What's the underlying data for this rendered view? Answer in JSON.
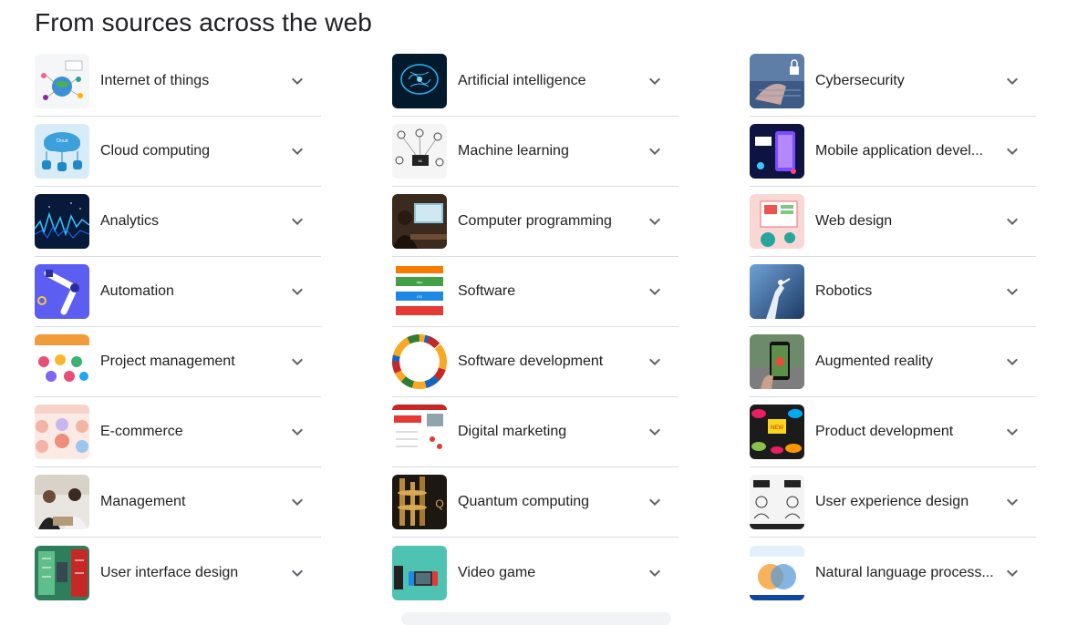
{
  "section": {
    "title": "From sources across the web"
  },
  "columns": [
    {
      "items": [
        {
          "label": "Internet of things",
          "icon": "iot-diagram-image"
        },
        {
          "label": "Cloud computing",
          "icon": "cloud-computing-image"
        },
        {
          "label": "Analytics",
          "icon": "analytics-waveform-image"
        },
        {
          "label": "Automation",
          "icon": "robot-arm-image"
        },
        {
          "label": "Project management",
          "icon": "project-management-chart-image"
        },
        {
          "label": "E-commerce",
          "icon": "ecommerce-types-image"
        },
        {
          "label": "Management",
          "icon": "business-meeting-photo"
        },
        {
          "label": "User interface design",
          "icon": "ui-wireframe-image"
        }
      ]
    },
    {
      "items": [
        {
          "label": "Artificial intelligence",
          "icon": "ai-brain-image"
        },
        {
          "label": "Machine learning",
          "icon": "machine-learning-sketch-image"
        },
        {
          "label": "Computer programming",
          "icon": "programmer-photo"
        },
        {
          "label": "Software",
          "icon": "software-layers-image"
        },
        {
          "label": "Software development",
          "icon": "sdlc-cycle-image"
        },
        {
          "label": "Digital marketing",
          "icon": "digital-marketing-image"
        },
        {
          "label": "Quantum computing",
          "icon": "quantum-computer-photo"
        },
        {
          "label": "Video game",
          "icon": "game-console-image"
        }
      ]
    },
    {
      "items": [
        {
          "label": "Cybersecurity",
          "icon": "keyboard-lock-photo"
        },
        {
          "label": "Mobile application devel...",
          "icon": "mobile-app-image"
        },
        {
          "label": "Web design",
          "icon": "web-design-illustration"
        },
        {
          "label": "Robotics",
          "icon": "robot-hand-photo"
        },
        {
          "label": "Augmented reality",
          "icon": "ar-phone-photo"
        },
        {
          "label": "Product development",
          "icon": "product-development-chalkboard"
        },
        {
          "label": "User experience design",
          "icon": "ux-vs-ui-image"
        },
        {
          "label": "Natural language process...",
          "icon": "nlp-venn-image"
        }
      ]
    }
  ]
}
